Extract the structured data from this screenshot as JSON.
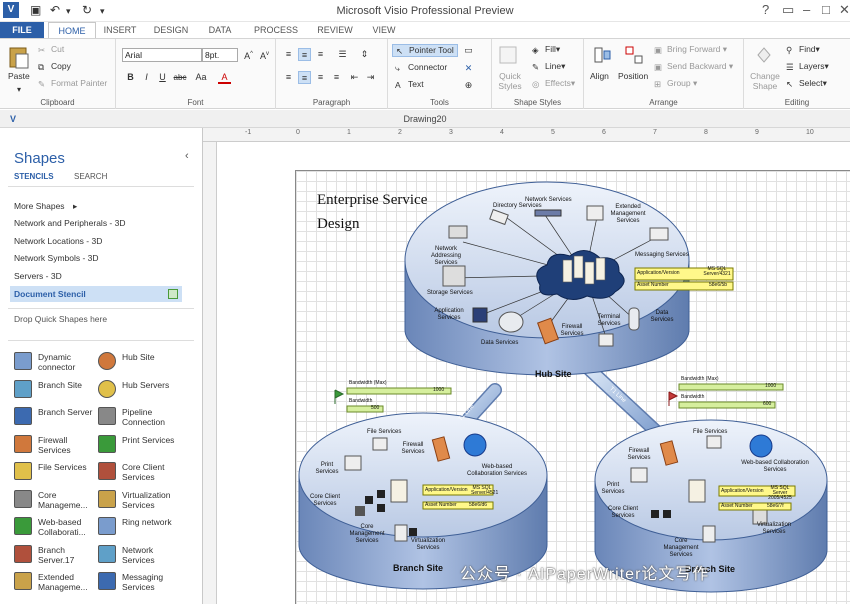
{
  "window": {
    "title": "Microsoft Visio Professional Preview",
    "document_title": "Drawing20"
  },
  "tabs": [
    "FILE",
    "HOME",
    "INSERT",
    "DESIGN",
    "DATA",
    "PROCESS",
    "REVIEW",
    "VIEW"
  ],
  "ribbon": {
    "clipboard": {
      "label": "Clipboard",
      "paste": "Paste",
      "cut": "Cut",
      "copy": "Copy",
      "format_painter": "Format Painter"
    },
    "font": {
      "label": "Font",
      "family": "Arial",
      "size": "8pt.",
      "bold": "B",
      "italic": "I",
      "underline": "U",
      "strike": "abc",
      "case": "Aa",
      "color": "A"
    },
    "paragraph": {
      "label": "Paragraph"
    },
    "tools": {
      "label": "Tools",
      "pointer": "Pointer Tool",
      "connector": "Connector",
      "text": "Text"
    },
    "shape_styles": {
      "label": "Shape Styles",
      "quick_styles": "Quick Styles",
      "fill": "Fill",
      "line": "Line",
      "effects": "Effects"
    },
    "arrange": {
      "label": "Arrange",
      "align": "Align",
      "position": "Position",
      "bring_forward": "Bring Forward",
      "send_backward": "Send Backward",
      "group": "Group"
    },
    "editing": {
      "label": "Editing",
      "change_shape": "Change Shape",
      "find": "Find",
      "layers": "Layers",
      "select": "Select"
    }
  },
  "shapes_pane": {
    "title": "Shapes",
    "tabs": [
      "STENCILS",
      "SEARCH"
    ],
    "stencils": [
      "More Shapes",
      "Network and Peripherals - 3D",
      "Network Locations - 3D",
      "Network Symbols - 3D",
      "Servers - 3D",
      "Document Stencil"
    ],
    "drop_hint": "Drop Quick Shapes here",
    "items": [
      [
        "Dynamic connector",
        "Hub Site"
      ],
      [
        "Branch Site",
        "Hub Servers"
      ],
      [
        "Branch Server",
        "Pipeline Connection"
      ],
      [
        "Firewall Services",
        "Print Services"
      ],
      [
        "File Services",
        "Core Client Services"
      ],
      [
        "Core Manageme...",
        "Virtualization Services"
      ],
      [
        "Web-based Collaborati...",
        "Ring network"
      ],
      [
        "Branch Server.17",
        "Network Services"
      ],
      [
        "Extended Manageme...",
        "Messaging Services"
      ]
    ]
  },
  "ruler": [
    "-1",
    "0",
    "1",
    "2",
    "3",
    "4",
    "5",
    "6",
    "7",
    "8",
    "9",
    "10"
  ],
  "diagram": {
    "title": "Enterprise Service Design",
    "hub": {
      "name": "Hub Site",
      "services": [
        "Directory Services",
        "Network Services",
        "Extended Management Services",
        "Network Addressing Services",
        "Messaging Services",
        "Storage Services",
        "Application Services",
        "Firewall Services",
        "Terminal Services",
        "Data Services",
        "Data Services"
      ],
      "app_version": "Application/Version",
      "app_version_val": "MS SQL Server/4321",
      "asset": "Asset Number",
      "asset_val": "58e6/5b"
    },
    "branches": [
      {
        "name": "Branch Site",
        "services": [
          "File Services",
          "Firewall Services",
          "Print Services",
          "Web-based Collaboration Services",
          "Core Client Services",
          "Core Management Services",
          "Virtualization Services"
        ],
        "app_version": "Application/Version",
        "app_version_val": "MS SQL Server/4521",
        "asset": "Asset Number",
        "asset_val": "58e6/d6"
      },
      {
        "name": "Branch Site",
        "services": [
          "File Services",
          "Firewall Services",
          "Print Services",
          "Web-based Collaboration Services",
          "Core Client Services",
          "Core Management Services",
          "Virtualization Services"
        ],
        "app_version": "Application/Version",
        "app_version_val": "MS SQL Server 2005/4525",
        "asset": "Asset Number",
        "asset_val": "58e6/7f"
      }
    ],
    "links": [
      {
        "label": "T1 Line",
        "bw_max": "Bandwidth (Max)",
        "bw_max_val": "1000",
        "bw": "Bandwidth",
        "bw_val": "500"
      },
      {
        "label": "T1 Line",
        "bw_max": "Bandwidth (Max)",
        "bw_max_val": "1000",
        "bw": "Bandwidth",
        "bw_val": "600"
      }
    ]
  },
  "watermark": "公众号 · AIPaperWriter论文写作"
}
